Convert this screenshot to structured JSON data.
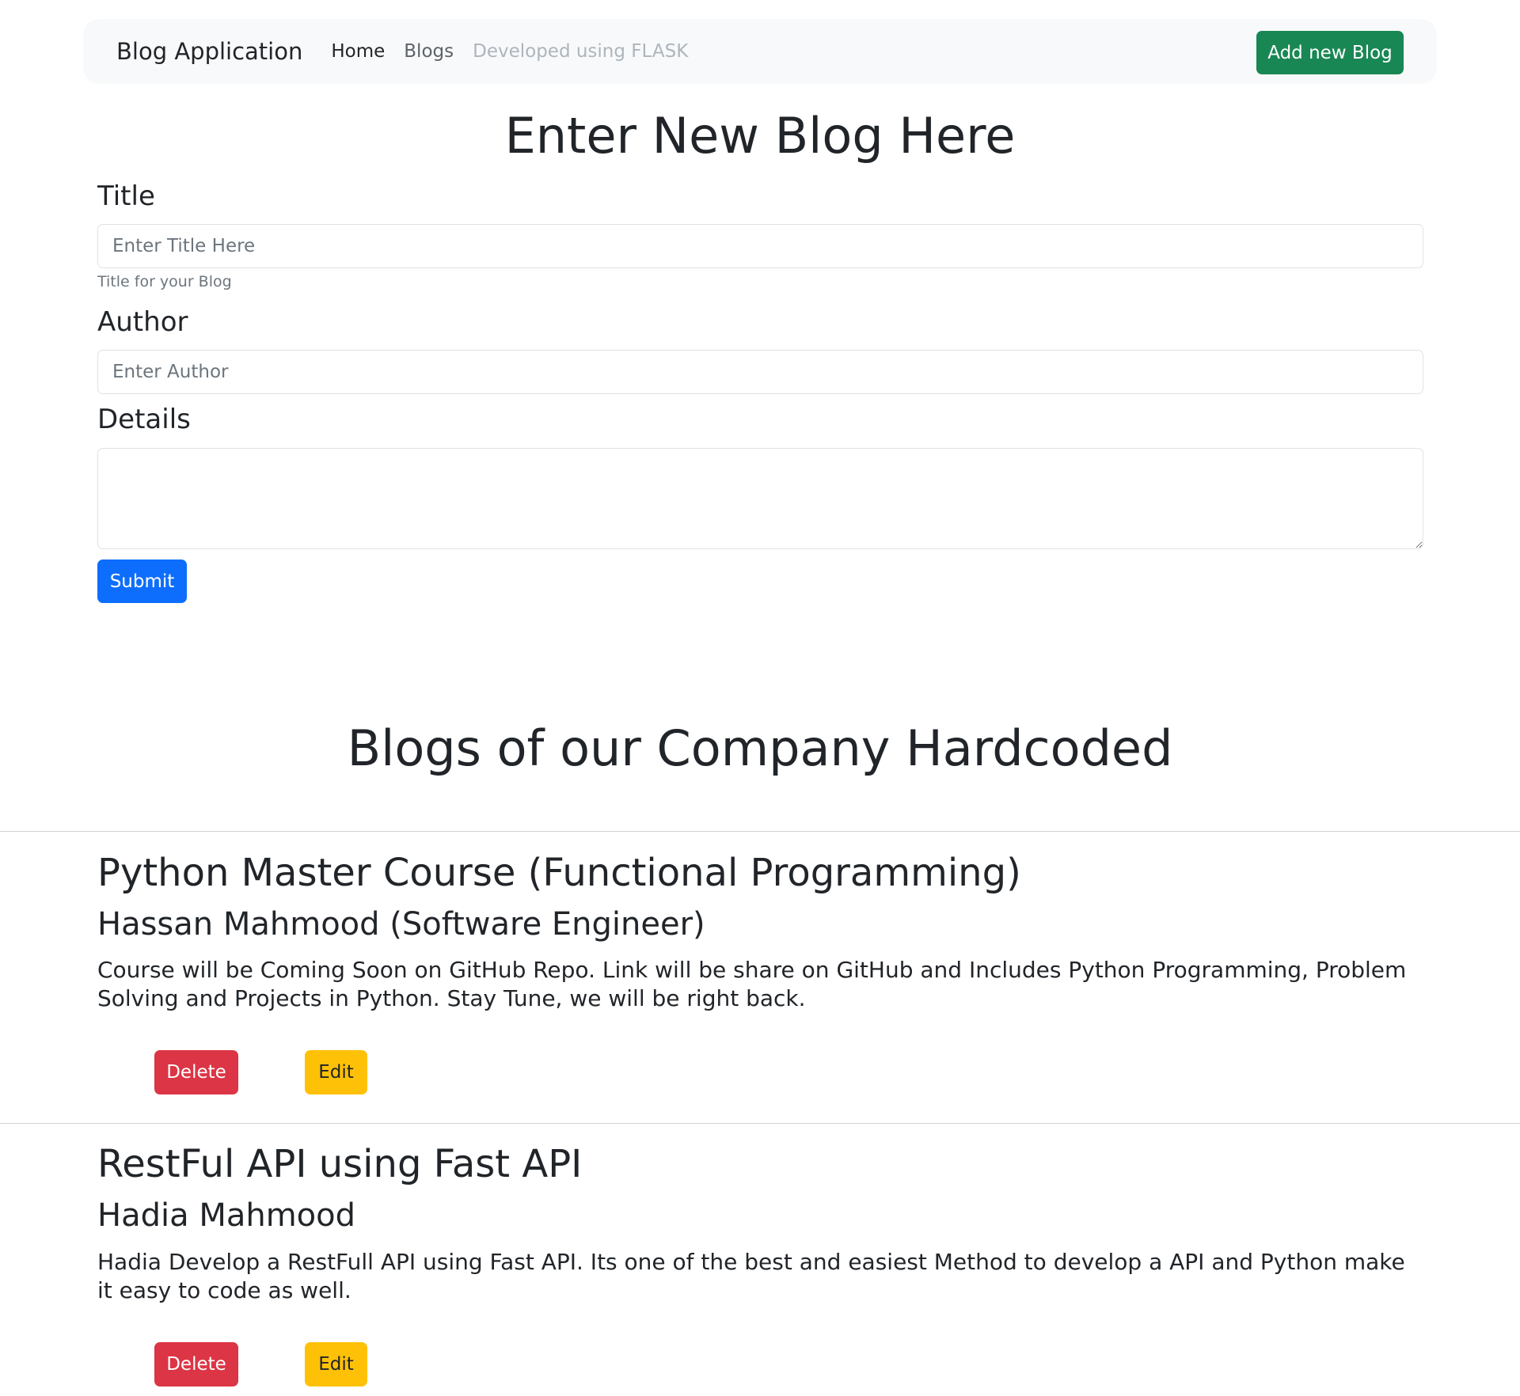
{
  "navbar": {
    "brand": "Blog Application",
    "links": [
      {
        "label": "Home",
        "state": "active"
      },
      {
        "label": "Blogs",
        "state": "normal"
      },
      {
        "label": "Developed using FLASK",
        "state": "disabled"
      }
    ],
    "add_button_label": "Add new Blog"
  },
  "form": {
    "heading": "Enter New Blog Here",
    "title_label": "Title",
    "title_placeholder": "Enter Title Here",
    "title_help": "Title for your Blog",
    "author_label": "Author",
    "author_placeholder": "Enter Author",
    "details_label": "Details",
    "details_value": "",
    "submit_label": "Submit"
  },
  "blogs": {
    "heading": "Blogs of our Company Hardcoded",
    "items": [
      {
        "title": "Python Master Course (Functional Programming)",
        "author": "Hassan Mahmood (Software Engineer)",
        "details": "Course will be Coming Soon on GitHub Repo. Link will be share on GitHub and Includes Python Programming, Problem Solving and Projects in Python. Stay Tune, we will be right back.",
        "delete_label": "Delete",
        "edit_label": "Edit"
      },
      {
        "title": "RestFul API using Fast API",
        "author": "Hadia Mahmood",
        "details": "Hadia Develop a RestFull API using Fast API. Its one of the best and easiest Method to develop a API and Python make it easy to code as well.",
        "delete_label": "Delete",
        "edit_label": "Edit"
      }
    ]
  },
  "colors": {
    "success": "#198754",
    "primary": "#0d6efd",
    "danger": "#dc3545",
    "warning": "#ffc107",
    "navbar_bg": "#f8f9fa"
  }
}
